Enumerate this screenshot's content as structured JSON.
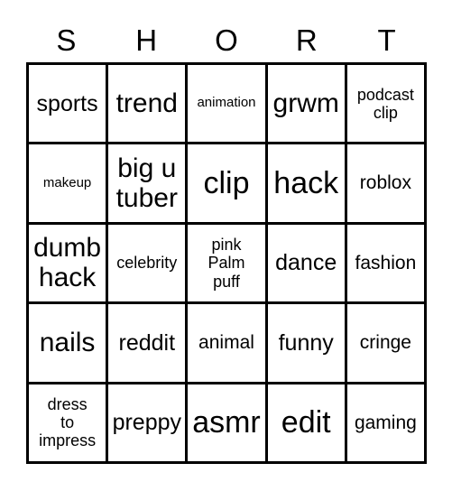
{
  "card": {
    "header_letters": [
      "S",
      "H",
      "O",
      "R",
      "T"
    ],
    "grid": {
      "columns": 5,
      "rows": 5,
      "border_color": "#000000",
      "background_color": "#ffffff",
      "text_color": "#000000"
    },
    "cells": [
      {
        "text": "sports",
        "size": "fs-md"
      },
      {
        "text": "trend",
        "size": "fs-lg"
      },
      {
        "text": "animation",
        "size": "fs-xxs"
      },
      {
        "text": "grwm",
        "size": "fs-lg"
      },
      {
        "text": "podcast\nclip",
        "size": "fs-xs"
      },
      {
        "text": "makeup",
        "size": "fs-xxs"
      },
      {
        "text": "big u\ntuber",
        "size": "fs-lg"
      },
      {
        "text": "clip",
        "size": "fs-xl"
      },
      {
        "text": "hack",
        "size": "fs-xl"
      },
      {
        "text": "roblox",
        "size": "fs-sm"
      },
      {
        "text": "dumb\nhack",
        "size": "fs-lg"
      },
      {
        "text": "celebrity",
        "size": "fs-xs"
      },
      {
        "text": "pink\nPalm\npuff",
        "size": "fs-xs"
      },
      {
        "text": "dance",
        "size": "fs-md"
      },
      {
        "text": "fashion",
        "size": "fs-sm"
      },
      {
        "text": "nails",
        "size": "fs-lg"
      },
      {
        "text": "reddit",
        "size": "fs-md"
      },
      {
        "text": "animal",
        "size": "fs-sm"
      },
      {
        "text": "funny",
        "size": "fs-md"
      },
      {
        "text": "cringe",
        "size": "fs-sm"
      },
      {
        "text": "dress\nto\nimpress",
        "size": "fs-xs"
      },
      {
        "text": "preppy",
        "size": "fs-md"
      },
      {
        "text": "asmr",
        "size": "fs-xl"
      },
      {
        "text": "edit",
        "size": "fs-xl"
      },
      {
        "text": "gaming",
        "size": "fs-sm"
      }
    ]
  }
}
